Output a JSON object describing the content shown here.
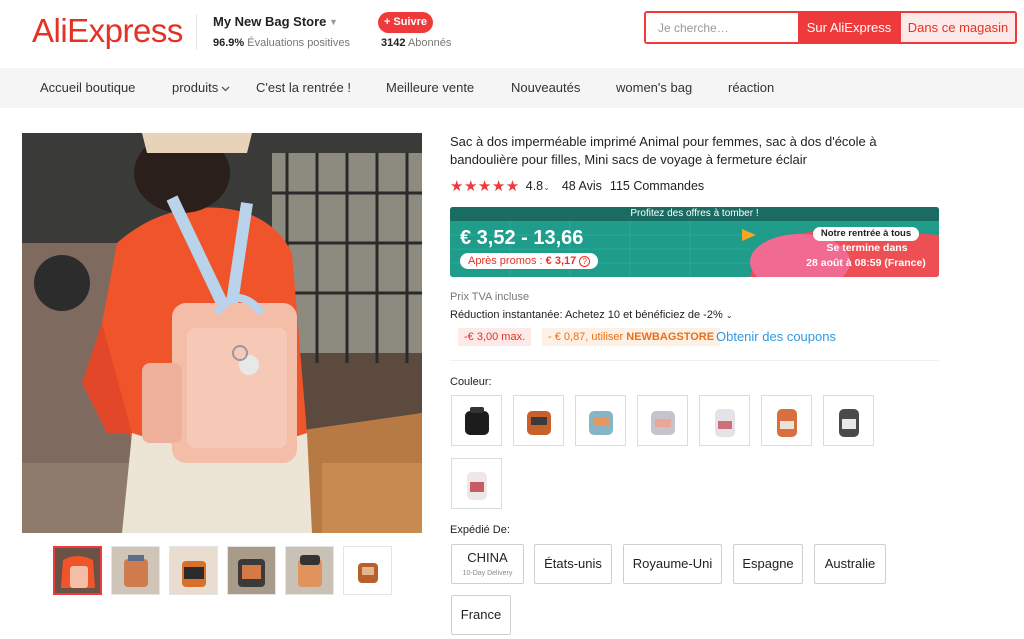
{
  "header": {
    "logo": "AliExpress",
    "store_name": "My New Bag Store",
    "rating_value": "96.9%",
    "rating_label": "Évaluations positives",
    "follow_label": "+ Suivre",
    "followers_count": "3142",
    "followers_label": "Abonnés",
    "search_placeholder": "Je cherche…",
    "search_btn": "Sur AliExpress",
    "store_btn": "Dans ce magasin"
  },
  "nav": {
    "items": [
      "Accueil boutique",
      "produits",
      "C'est la rentrée !",
      "Meilleure vente",
      "Nouveautés",
      "women's bag",
      "réaction"
    ]
  },
  "product": {
    "title": "Sac à dos imperméable imprimé Animal pour femmes, sac à dos d'école à bandoulière pour filles, Mini sacs de voyage à fermeture éclair",
    "stars": "★★★★★",
    "rating": "4.8",
    "reviews": "48 Avis",
    "orders": "115 Commandes"
  },
  "promo": {
    "banner": "Profitez des offres à tomber !",
    "price": "€ 3,52 - 13,66",
    "after_label": "Après promos :",
    "after_price": "€ 3,17",
    "badge": "Notre rentrée à tous",
    "ends_line1": "Se termine dans",
    "ends_line2": "28 août à 08:59 (France)"
  },
  "pricing": {
    "tva": "Prix TVA incluse",
    "reduction": "Réduction instantanée: Achetez 10 et bénéficiez de -2%",
    "coupon1": "-€ 3,00 max.",
    "coupon2_prefix": "- € 0,87, utiliser",
    "coupon2_code": "NEWBAGSTORE",
    "coupon_link": "Obtenir des coupons"
  },
  "color": {
    "label": "Couleur:"
  },
  "shipping": {
    "label": "Expédié De:",
    "china": "CHINA",
    "china_sub": "10-Day Delivery",
    "options": [
      "États-unis",
      "Royaume-Uni",
      "Espagne",
      "Australie",
      "France"
    ]
  },
  "colors": {
    "accent": "#ee3a3a",
    "promo_green": "#1e9e8c",
    "link": "#2e9be0"
  }
}
